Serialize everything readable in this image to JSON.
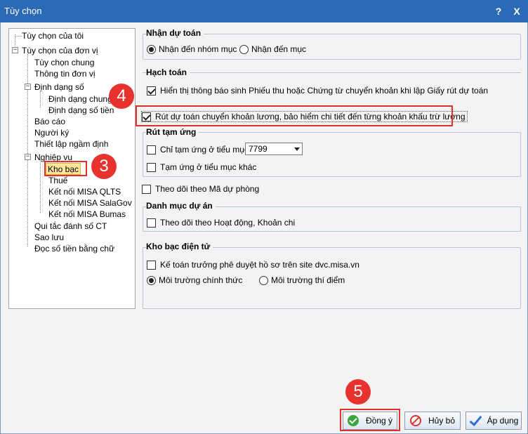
{
  "window": {
    "title": "Tùy chọn",
    "help_label": "?",
    "close_label": "X"
  },
  "tree": {
    "items": [
      "Tùy chọn của tôi",
      "Tùy chọn của đơn vị",
      "Tùy chọn chung",
      "Thông tin đơn vị",
      "Định dạng số",
      "Định dạng chung",
      "Định dạng số tiền",
      "Báo cáo",
      "Người ký",
      "Thiết lập ngầm định",
      "Nghiệp vụ",
      "Kho bạc",
      "Thuế",
      "Kết nối MISA QLTS",
      "Kết nối MISA SalaGov",
      "Kết nối MISA Bumas",
      "Qui tắc đánh số CT",
      "Sao lưu",
      "Đọc số tiền bằng chữ"
    ],
    "selected": "Kho bạc",
    "expander_collapse": "−"
  },
  "groups": {
    "nhan_du_toan": {
      "title": "Nhận dự toán",
      "radio_1": "Nhận đến nhóm mục",
      "radio_2": "Nhận đến mục"
    },
    "hach_toan": {
      "title": "Hạch toán",
      "opt_1": "Hiển thị thông báo sinh Phiếu thu hoặc Chứng từ chuyển khoản khi lập Giấy rút dự toán",
      "opt_2": "Rút dự toán chuyển khoản lương, bảo hiểm chi tiết đến từng khoản khấu trừ lương"
    },
    "rut_tam_ung": {
      "title": "Rút tạm ứng",
      "opt_1": "Chỉ tạm ứng ở tiểu mục",
      "select_value": "7799",
      "opt_2": "Tạm ứng ở tiểu mục khác"
    },
    "theo_doi_ma_du_phong": "Theo dõi theo Mã dự phòng",
    "danh_muc_du_an": {
      "title": "Danh mục dự án",
      "opt_1": "Theo dõi theo Hoạt động, Khoản chi"
    },
    "kho_bac_dien_tu": {
      "title": "Kho bạc điện tử",
      "opt_1": "Kế toán trưởng phê duyệt hồ sơ trên site dvc.misa.vn",
      "radio_1": "Môi trường chính thức",
      "radio_2": "Môi trường thí điểm"
    }
  },
  "badges": {
    "b3": "3",
    "b4": "4",
    "b5": "5"
  },
  "buttons": {
    "ok": "Đồng ý",
    "cancel": "Hủy bỏ",
    "apply": "Áp dụng"
  },
  "colors": {
    "titlebar": "#2b6bb5",
    "highlight": "#e0302c",
    "selected_node": "#ffe59a"
  }
}
